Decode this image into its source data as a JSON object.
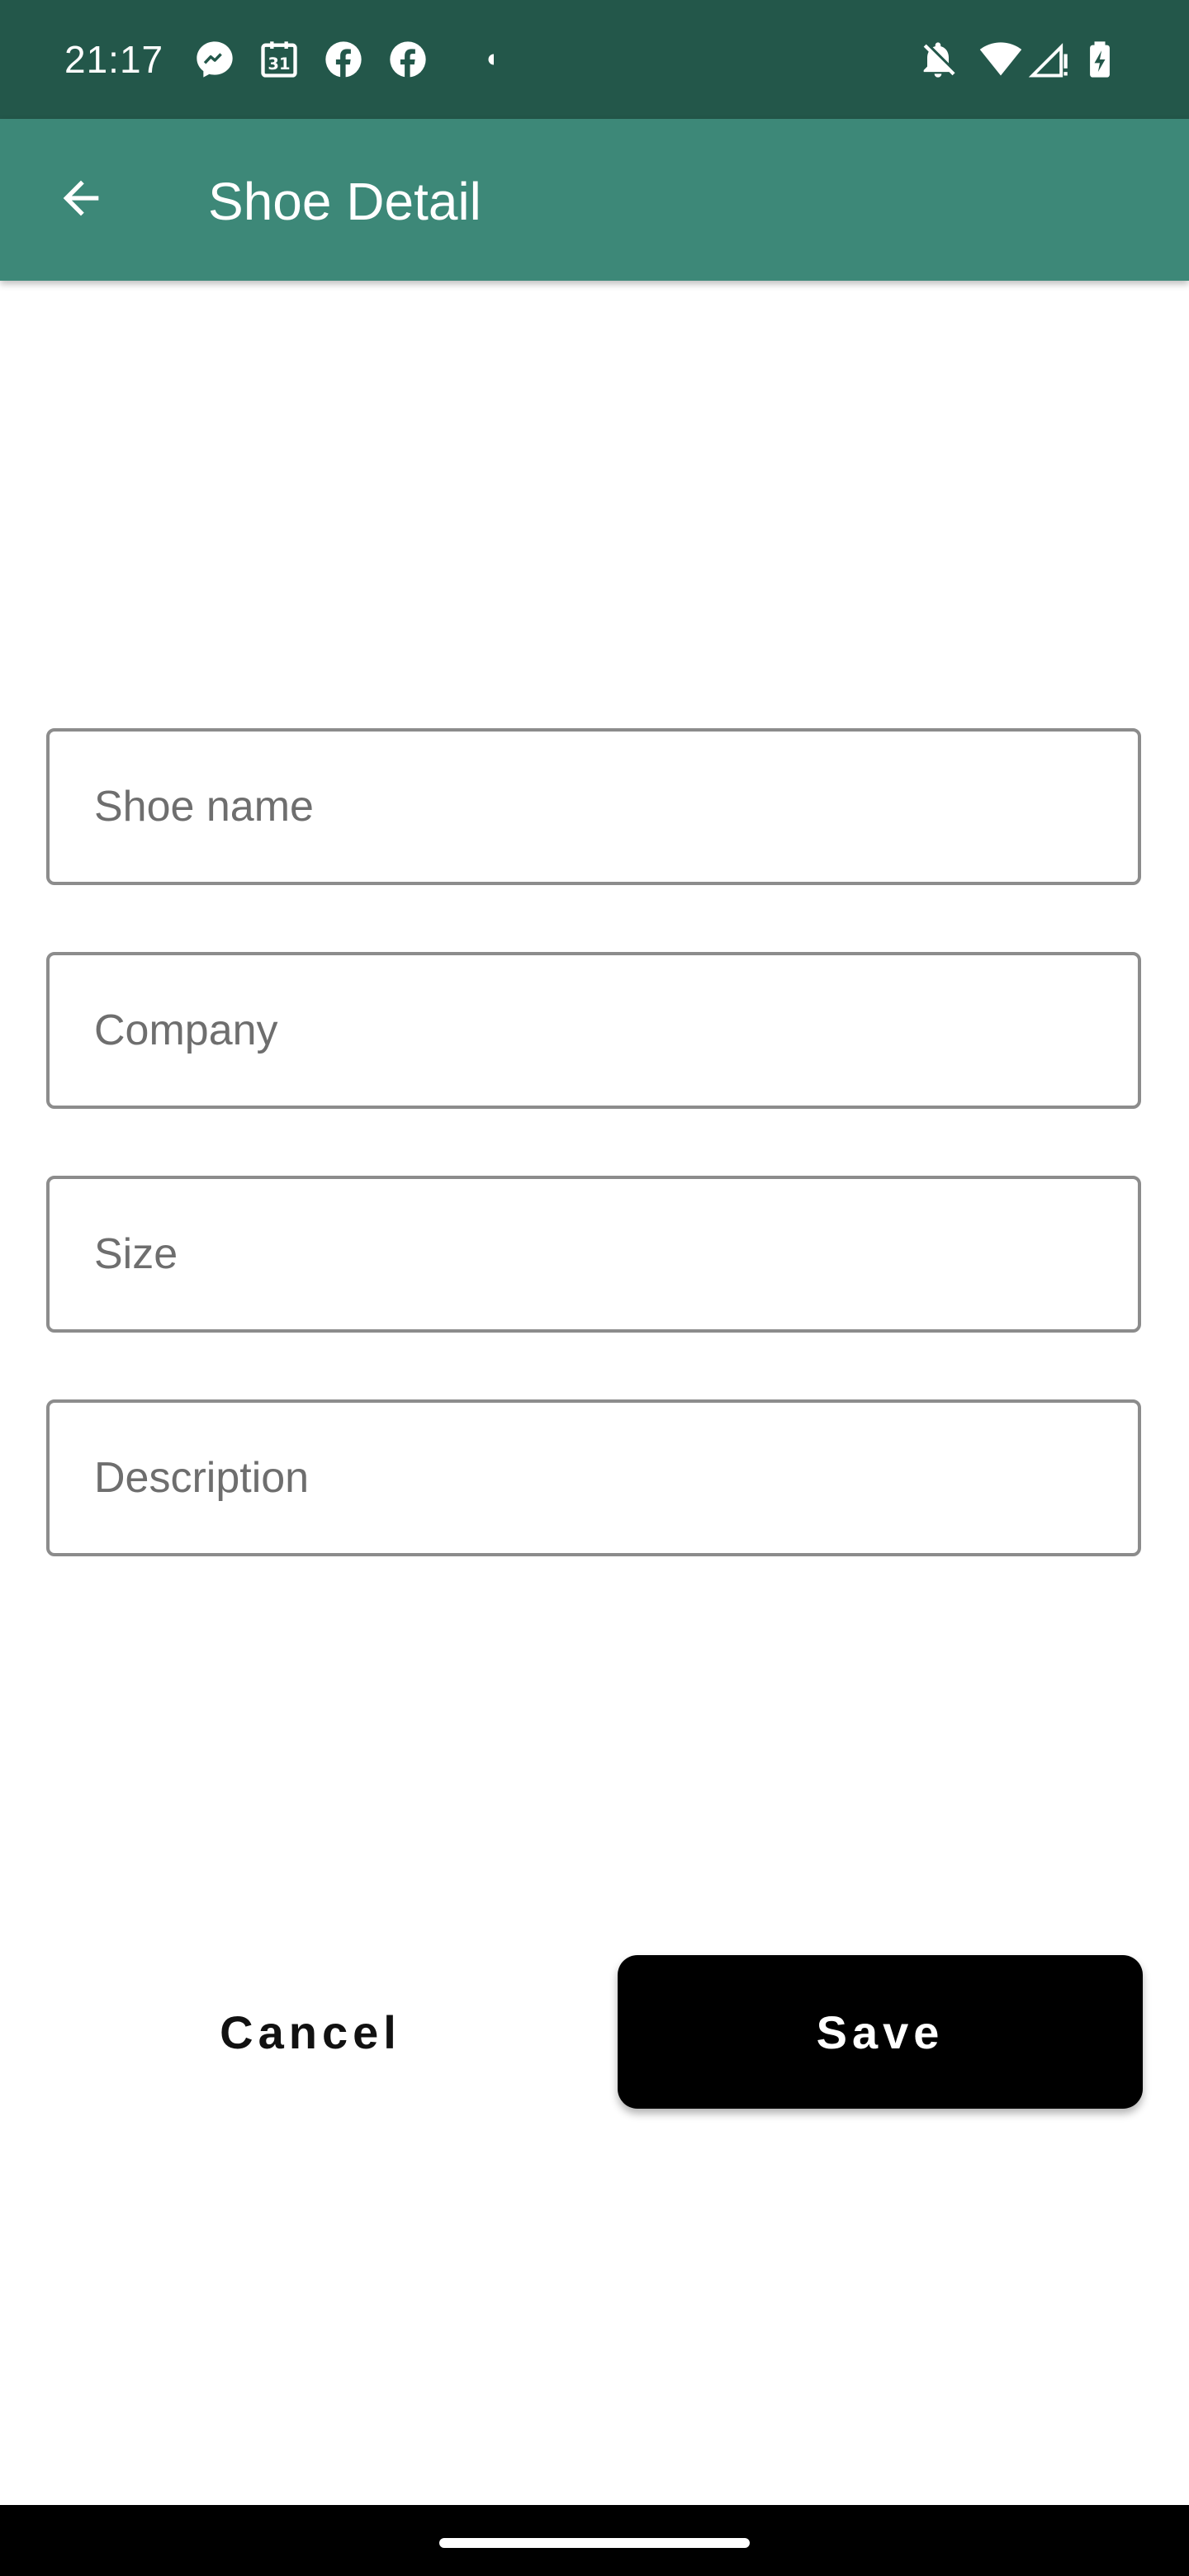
{
  "status_bar": {
    "time": "21:17",
    "notification_icons": [
      "messenger-icon",
      "calendar-icon",
      "facebook-icon",
      "facebook-icon",
      "dot-icon"
    ],
    "calendar_day": "31",
    "system_icons": [
      "bell-off-icon",
      "wifi-icon",
      "signal-icon",
      "battery-icon"
    ],
    "background": "#23574a"
  },
  "app_bar": {
    "title": "Shoe Detail",
    "back_icon": "arrow-back-icon",
    "background": "#3d8878"
  },
  "form": {
    "shoe_name": {
      "value": "",
      "placeholder": "Shoe name"
    },
    "company": {
      "value": "",
      "placeholder": "Company"
    },
    "size": {
      "value": "",
      "placeholder": "Size"
    },
    "description": {
      "value": "",
      "placeholder": "Description"
    }
  },
  "actions": {
    "cancel_label": "Cancel",
    "save_label": "Save"
  }
}
